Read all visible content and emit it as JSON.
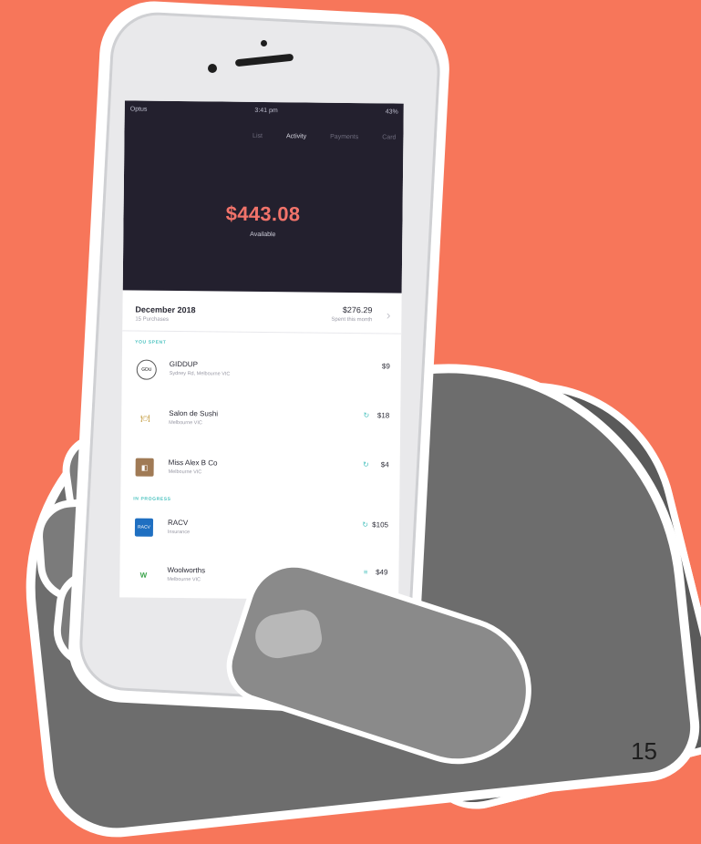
{
  "status_bar": {
    "carrier": "Optus",
    "time": "3:41 pm",
    "battery": "43%"
  },
  "tabs": [
    "List",
    "Activity",
    "Payments",
    "Card"
  ],
  "active_tab_index": 1,
  "balance": {
    "amount": "$443.08",
    "label": "Available"
  },
  "month": {
    "title": "December 2018",
    "subtitle": "15 Purchases",
    "amount": "$276.29",
    "amount_subtitle": "Spent this month"
  },
  "sections": [
    {
      "title": "YOU SPENT",
      "transactions": [
        {
          "icon": "giddyup-logo-icon",
          "glyph": "GDU",
          "name": "GIDDUP",
          "sub": "Sydney Rd, Melbourne VIC",
          "amount": "$9",
          "flag": ""
        },
        {
          "icon": "restaurant-icon",
          "glyph": "🍽",
          "name": "Salon de Sushi",
          "sub": "Melbourne VIC",
          "amount": "$18",
          "flag": "↻"
        },
        {
          "icon": "store-icon",
          "glyph": "◧",
          "name": "Miss Alex B Co",
          "sub": "Melbourne VIC",
          "amount": "$4",
          "flag": "↻"
        }
      ]
    },
    {
      "title": "IN PROGRESS",
      "transactions": [
        {
          "icon": "racv-logo-icon",
          "glyph": "RACV",
          "name": "RACV",
          "sub": "Insurance",
          "amount": "$105",
          "flag": "↻"
        },
        {
          "icon": "woolworths-logo-icon",
          "glyph": "W",
          "name": "Woolworths",
          "sub": "Melbourne VIC",
          "amount": "$49",
          "flag": "≡"
        }
      ]
    }
  ],
  "page_number": "15",
  "colors": {
    "background": "#f7765a",
    "hero": "#23202e",
    "accent": "#f1736a",
    "teal": "#4dc3c0"
  }
}
